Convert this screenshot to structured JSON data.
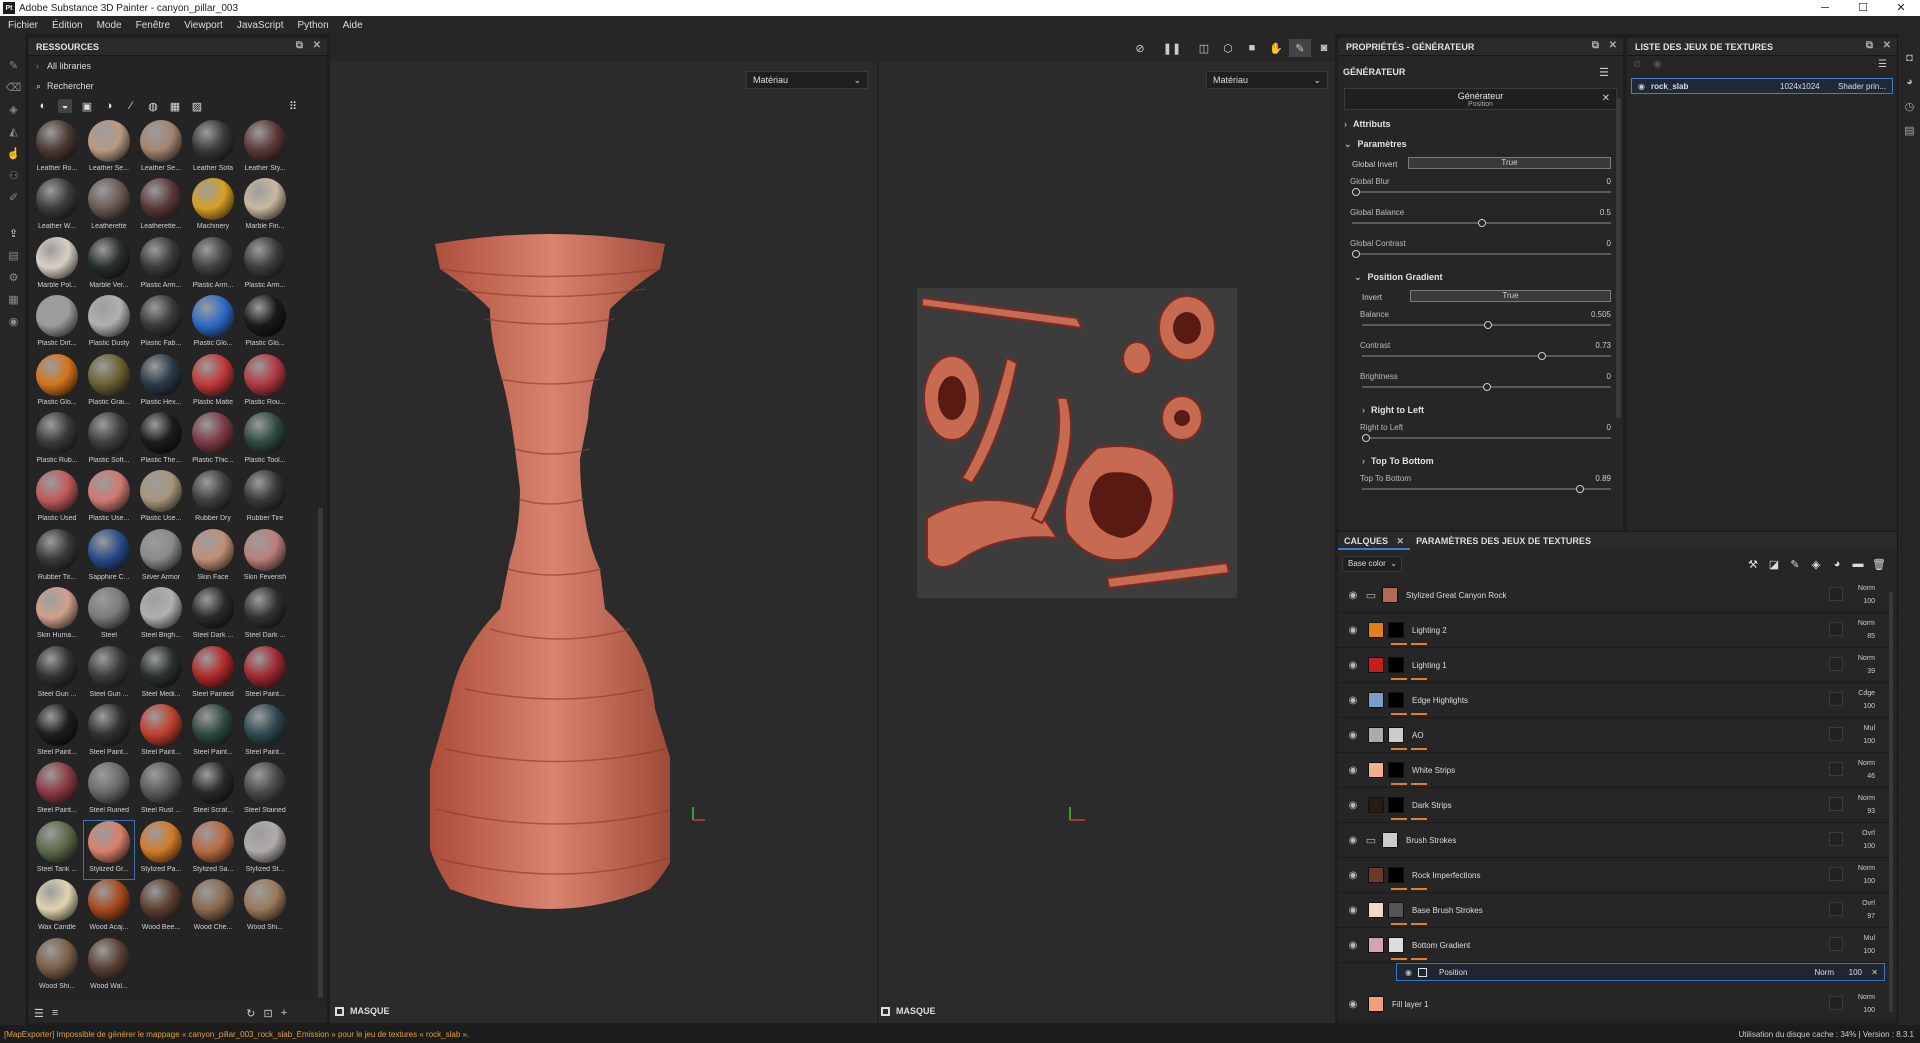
{
  "window": {
    "title": "Adobe Substance 3D Painter - canyon_pillar_003",
    "logo": "Pt"
  },
  "menu": [
    "Fichier",
    "Édition",
    "Mode",
    "Fenêtre",
    "Viewport",
    "JavaScript",
    "Python",
    "Aide"
  ],
  "resources": {
    "header": "RESSOURCES",
    "all_libraries": "All libraries",
    "search_placeholder": "Rechercher",
    "materials": [
      {
        "label": "Leather Ro...",
        "color": "#4a3a33"
      },
      {
        "label": "Leather Se...",
        "color": "#b89a82"
      },
      {
        "label": "Leather Se...",
        "color": "#a28670"
      },
      {
        "label": "Leather Sofa",
        "color": "#3a3939"
      },
      {
        "label": "Leather Sty...",
        "color": "#5a3a36"
      },
      {
        "label": "Leather W...",
        "color": "#3c3c3c"
      },
      {
        "label": "Leatherette",
        "color": "#6b5a52"
      },
      {
        "label": "Leatherette...",
        "color": "#5a3836"
      },
      {
        "label": "Machinery",
        "color": "#d6a124"
      },
      {
        "label": "Marble Fin...",
        "color": "#c8b8a0"
      },
      {
        "label": "Marble Pol...",
        "color": "#d8d0c4"
      },
      {
        "label": "Marble Ver...",
        "color": "#26302b"
      },
      {
        "label": "Plastic Arm...",
        "color": "#3a3a3a"
      },
      {
        "label": "Plastic Arm...",
        "color": "#404040"
      },
      {
        "label": "Plastic Arm...",
        "color": "#3c3c3c"
      },
      {
        "label": "Plastic Dirt...",
        "color": "#9c9c9c"
      },
      {
        "label": "Plastic Dusty",
        "color": "#b0b0b0"
      },
      {
        "label": "Plastic Fab...",
        "color": "#3a3a3a"
      },
      {
        "label": "Plastic Glo...",
        "color": "#2e6ac6"
      },
      {
        "label": "Plastic Glo...",
        "color": "#1a1a1a"
      },
      {
        "label": "Plastic Glo...",
        "color": "#d2741c"
      },
      {
        "label": "Plastic Grai...",
        "color": "#6a6232"
      },
      {
        "label": "Plastic Hex...",
        "color": "#2a3a4a"
      },
      {
        "label": "Plastic Matte",
        "color": "#c03a3a"
      },
      {
        "label": "Plastic Rou...",
        "color": "#b03a44"
      },
      {
        "label": "Plastic Rub...",
        "color": "#3a3a3a"
      },
      {
        "label": "Plastic Soft...",
        "color": "#3e3e3e"
      },
      {
        "label": "Plastic The...",
        "color": "#1c1c1c"
      },
      {
        "label": "Plastic Thic...",
        "color": "#7a3a44"
      },
      {
        "label": "Plastic Tool...",
        "color": "#2e4a3e"
      },
      {
        "label": "Plastic Used",
        "color": "#c05a5a"
      },
      {
        "label": "Plastic Use...",
        "color": "#d07a70"
      },
      {
        "label": "Plastic Use...",
        "color": "#a8967c"
      },
      {
        "label": "Rubber Dry",
        "color": "#3e3e3e"
      },
      {
        "label": "Rubber Tire",
        "color": "#383838"
      },
      {
        "label": "Rubber Tir...",
        "color": "#3a3a3a"
      },
      {
        "label": "Sapphire C...",
        "color": "#2a4a8a"
      },
      {
        "label": "Silver Armor",
        "color": "#8a8a8a"
      },
      {
        "label": "Skin Face",
        "color": "#c09078"
      },
      {
        "label": "Skin Feverish",
        "color": "#b8807a"
      },
      {
        "label": "Skin Huma...",
        "color": "#d0a08c"
      },
      {
        "label": "Steel",
        "color": "#7a7a7a"
      },
      {
        "label": "Steel Brigh...",
        "color": "#b0b0b0"
      },
      {
        "label": "Steel Dark ...",
        "color": "#2a2a2a"
      },
      {
        "label": "Steel Dark ...",
        "color": "#333333"
      },
      {
        "label": "Steel Gun ...",
        "color": "#333333"
      },
      {
        "label": "Steel Gun ...",
        "color": "#3c3c3c"
      },
      {
        "label": "Steel Medi...",
        "color": "#2a3030"
      },
      {
        "label": "Steel Painted",
        "color": "#b02a2a"
      },
      {
        "label": "Steel Paint...",
        "color": "#a02a32"
      },
      {
        "label": "Steel Paint...",
        "color": "#1e1e1e"
      },
      {
        "label": "Steel Paint...",
        "color": "#333333"
      },
      {
        "label": "Steel Paint...",
        "color": "#c0402e"
      },
      {
        "label": "Steel Paint...",
        "color": "#2e4a3e"
      },
      {
        "label": "Steel Paint...",
        "color": "#2e4a50"
      },
      {
        "label": "Steel Paint...",
        "color": "#8a3a44"
      },
      {
        "label": "Steel Ruined",
        "color": "#6a6a6a"
      },
      {
        "label": "Steel Rust ...",
        "color": "#5a5a5a"
      },
      {
        "label": "Steel Scrat...",
        "color": "#2a2a2a"
      },
      {
        "label": "Steel Stained",
        "color": "#4a4a4a"
      },
      {
        "label": "Steel Tank ...",
        "color": "#5a6a4a"
      },
      {
        "label": "Stylized Gr...",
        "color": "#d8806a"
      },
      {
        "label": "Stylized Pa...",
        "color": "#d27a2a"
      },
      {
        "label": "Stylized Sa...",
        "color": "#b86a44"
      },
      {
        "label": "Stylized St...",
        "color": "#b0aca8"
      },
      {
        "label": "Wax Candle",
        "color": "#e0d4b0"
      },
      {
        "label": "Wood Acaj...",
        "color": "#a84a1e"
      },
      {
        "label": "Wood Bee...",
        "color": "#5a4030"
      },
      {
        "label": "Wood Che...",
        "color": "#8a6a50"
      },
      {
        "label": "Wood Shi...",
        "color": "#9a7a5a"
      },
      {
        "label": "Wood Shi...",
        "color": "#7a6048"
      },
      {
        "label": "Wood Wal...",
        "color": "#5a4034"
      }
    ],
    "selected_index": 61
  },
  "viewport": {
    "left_select": "Matériau",
    "right_select": "Matériau",
    "masque_left": "MASQUE",
    "masque_right": "MASQUE"
  },
  "properties": {
    "header": "PROPRIÉTÉS - GÉNÉRATEUR",
    "section": "GÉNÉRATEUR",
    "gen_title": "Générateur",
    "gen_sub": "Position",
    "attributs": "Attributs",
    "parametres": "Paramètres",
    "global_invert_label": "Global Invert",
    "global_invert_value": "True",
    "sliders_global": [
      {
        "name": "Global Blur",
        "value": "0",
        "pos": 0
      },
      {
        "name": "Global Balance",
        "value": "0.5",
        "pos": 0.5
      },
      {
        "name": "Global Contrast",
        "value": "0",
        "pos": 0
      }
    ],
    "position_gradient": "Position Gradient",
    "invert_label": "Invert",
    "invert_value": "True",
    "sliders_pg": [
      {
        "name": "Balance",
        "value": "0.505",
        "pos": 0.505
      },
      {
        "name": "Contrast",
        "value": "0.73",
        "pos": 0.73
      },
      {
        "name": "Brightness",
        "value": "0",
        "pos": 0.5
      }
    ],
    "right_to_left": "Right to Left",
    "rtl_slider": {
      "name": "Right to Left",
      "value": "0",
      "pos": 0
    },
    "top_to_bottom": "Top To Bottom",
    "ttb_slider": {
      "name": "Top To Bottom",
      "value": "0.89",
      "pos": 0.89
    }
  },
  "texture_sets": {
    "header": "LISTE DES JEUX DE TEXTURES",
    "name": "rock_slab",
    "size": "1024x1024",
    "shader": "Shader prin..."
  },
  "layers": {
    "tab_layers": "CALQUES",
    "tab_params": "PARAMÈTRES DES JEUX DE TEXTURES",
    "channel": "Base color",
    "items": [
      {
        "name": "Stylized Great Canyon Rock",
        "thumb": "#b06a58",
        "mask": "",
        "blend": "Norm",
        "opacity": "100",
        "folder": true
      },
      {
        "name": "Lighting 2",
        "thumb": "#e07f1a",
        "mask": "#000",
        "blend": "Norm",
        "opacity": "85"
      },
      {
        "name": "Lighting 1",
        "thumb": "#c41e1e",
        "mask": "#000",
        "blend": "Norm",
        "opacity": "39"
      },
      {
        "name": "Edge Highlights",
        "thumb": "#7a9cc6",
        "mask": "#000",
        "blend": "Cdge",
        "opacity": "100"
      },
      {
        "name": "AO",
        "thumb": "#aaaaaa",
        "mask": "#ccc",
        "blend": "Mul",
        "opacity": "100"
      },
      {
        "name": "White Strips",
        "thumb": "#f0b090",
        "mask": "#000",
        "blend": "Norm",
        "opacity": "46"
      },
      {
        "name": "Dark Strips",
        "thumb": "#2a1a14",
        "mask": "#000",
        "blend": "Norm",
        "opacity": "93"
      },
      {
        "name": "Brush Strokes",
        "thumb": "#cccccc",
        "mask": "",
        "blend": "Ovrl",
        "opacity": "100",
        "folder": true
      },
      {
        "name": "Rock Imperfections",
        "thumb": "#6a3a2a",
        "mask": "#000",
        "blend": "Norm",
        "opacity": "100"
      },
      {
        "name": "Base Brush Strokes",
        "thumb": "#f4d4cc",
        "mask": "#555",
        "blend": "Ovrl",
        "opacity": "97"
      },
      {
        "name": "Bottom Gradient",
        "thumb": "#d4a4b4",
        "mask": "#ddd",
        "blend": "Mul",
        "opacity": "100"
      }
    ],
    "effect": {
      "name": "Position",
      "blend": "Norm",
      "opacity": "100"
    },
    "fill_layer": {
      "name": "Fill layer 1",
      "thumb": "#f0a080",
      "blend": "Norm",
      "opacity": "100"
    }
  },
  "status": {
    "error": "[MapExporter] Impossible de générer le mappage « canyon_pillar_003_rock_slab_Emission » pour le jeu de textures « rock_slab ».",
    "info": "Utilisation du disque cache : 34% | Version : 8.3.1"
  }
}
